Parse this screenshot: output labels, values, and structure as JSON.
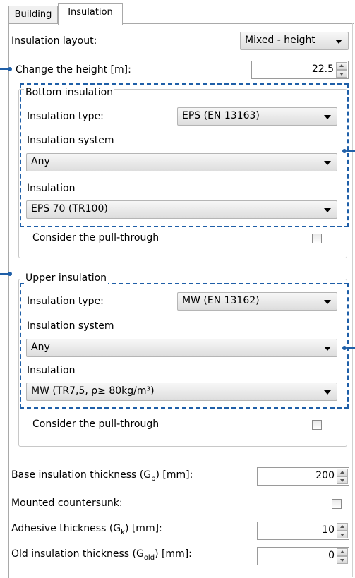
{
  "tabs": [
    {
      "label": "Building"
    },
    {
      "label": "Insulation"
    }
  ],
  "layout": {
    "label": "Insulation layout:",
    "value": "Mixed - height"
  },
  "height": {
    "label": "Change the height [m]:",
    "value": "22.5"
  },
  "bottom": {
    "title": "Bottom insulation",
    "type_label": "Insulation type:",
    "type_value": "EPS (EN 13163)",
    "system_label": "Insulation system",
    "system_value": "Any",
    "insulation_label": "Insulation",
    "insulation_value": "EPS 70 (TR100)",
    "pull_label": "Consider the pull-through"
  },
  "upper": {
    "title": "Upper insulation",
    "type_label": "Insulation type:",
    "type_value": "MW (EN 13162)",
    "system_label": "Insulation system",
    "system_value": "Any",
    "insulation_label": "Insulation",
    "insulation_value": "MW (TR7,5, ρ≥ 80kg/m³)",
    "pull_label": "Consider the pull-through"
  },
  "base": {
    "label_pre": "Base insulation thickness (G",
    "label_sub": "b",
    "label_post": ") [mm]:",
    "value": "200"
  },
  "countersunk": {
    "label": "Mounted countersunk:"
  },
  "adhesive": {
    "label_pre": "Adhesive thickness (G",
    "label_sub": "k",
    "label_post": ") [mm]:",
    "value": "10"
  },
  "old": {
    "label_pre": "Old insulation thickness (G",
    "label_sub": "old",
    "label_post": ") [mm]:",
    "value": "0"
  },
  "colors": {
    "annotation": "#1f5fa8",
    "border": "#a9a9a9"
  }
}
